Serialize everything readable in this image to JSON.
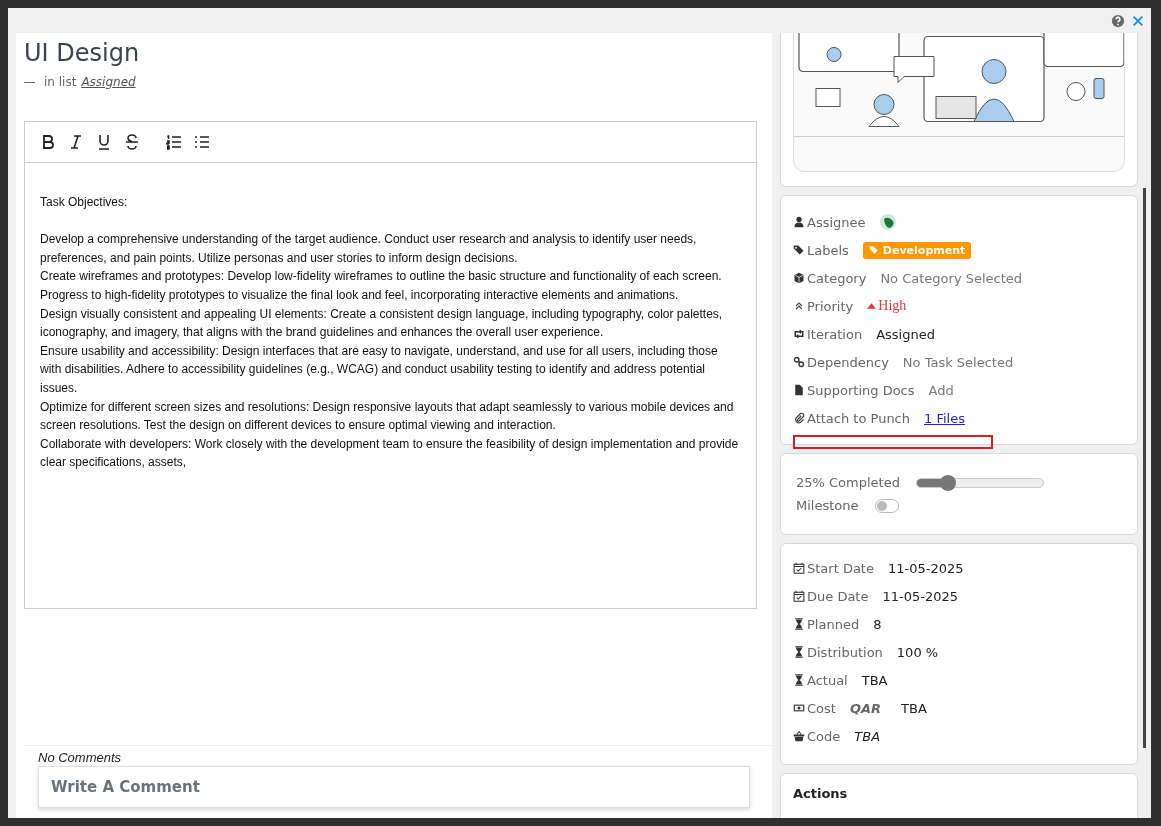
{
  "task": {
    "title": "UI Design",
    "list_prefix": "in list",
    "list_name": "Assigned"
  },
  "editor": {
    "toolbar": [
      {
        "kind": "bold"
      },
      {
        "kind": "italic"
      },
      {
        "kind": "underline"
      },
      {
        "kind": "strike"
      },
      {
        "kind": "ordered"
      },
      {
        "kind": "bullets"
      }
    ],
    "heading": "Task Objectives:",
    "paragraphs": [
      "Develop a comprehensive understanding of the target audience. Conduct user research and analysis to identify user needs, preferences, and pain points. Utilize personas and user stories to inform design decisions.",
      "Create wireframes and prototypes: Develop low-fidelity wireframes to outline the basic structure and functionality of each screen. Progress to high-fidelity prototypes to visualize the final look and feel, incorporating interactive elements and animations.",
      "Design visually consistent and appealing UI elements: Create a consistent design language, including typography, color palettes, iconography, and imagery, that aligns with the brand guidelines and enhances the overall user experience.",
      "Ensure usability and accessibility: Design interfaces that are easy to navigate, understand, and use for all users, including those with disabilities. Adhere to accessibility guidelines (e.g., WCAG) and conduct usability testing to identify and address potential issues.",
      "Optimize for different screen sizes and resolutions: Design responsive layouts that adapt seamlessly to various mobile devices and screen resolutions. Test the design on different devices to ensure optimal viewing and interaction.",
      "Collaborate with developers: Work closely with the development team to ensure the feasibility of design implementation and provide clear specifications, assets,"
    ]
  },
  "comments": {
    "status": "No Comments",
    "placeholder": "Write A Comment"
  },
  "fields": [
    {
      "label": "Assignee",
      "kind": "avatar"
    },
    {
      "label": "Labels",
      "kind": "tag",
      "value": "Development",
      "color": "#ff9800"
    },
    {
      "label": "Category",
      "kind": "muted",
      "value": "No Category Selected"
    },
    {
      "label": "Priority",
      "kind": "priority",
      "value": "High"
    },
    {
      "label": "Iteration",
      "kind": "text",
      "value": "Assigned"
    },
    {
      "label": "Dependency",
      "kind": "muted",
      "value": "No Task Selected"
    },
    {
      "label": "Supporting Docs",
      "kind": "muted",
      "value": "Add"
    },
    {
      "label": "Attach to Punch",
      "kind": "link",
      "value": "1 Files"
    }
  ],
  "progress": {
    "label": "25% Completed",
    "level": 0.25,
    "milestone_label": "Milestone",
    "milestone_on": false
  },
  "details": [
    {
      "label": "Start Date",
      "value": "11-05-2025"
    },
    {
      "label": "Due Date",
      "value": "11-05-2025"
    },
    {
      "label": "Planned",
      "value": "8"
    },
    {
      "label": "Distribution",
      "value": "100 %"
    },
    {
      "label": "Actual",
      "value": "TBA"
    },
    {
      "label": "Cost",
      "unit": "QAR",
      "value": "TBA"
    },
    {
      "label": "Code",
      "value": "TBA",
      "italic": true
    }
  ],
  "actions": {
    "title": "Actions"
  }
}
